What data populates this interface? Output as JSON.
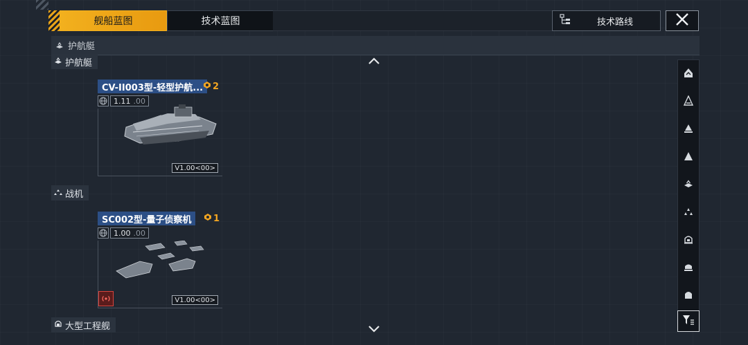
{
  "tabs": [
    {
      "label": "舰船蓝图",
      "active": true
    },
    {
      "label": "技术蓝图",
      "active": false
    }
  ],
  "route_button": {
    "label": "技术路线"
  },
  "category_bar": {
    "title": "护航艇"
  },
  "sections": [
    {
      "label": "护航艇"
    },
    {
      "label": "战机"
    },
    {
      "label": "大型工程舰"
    }
  ],
  "cards": [
    {
      "name": "CV-II003型-轻型护航...",
      "count": "2",
      "version": "1.11",
      "version_dim": ".00",
      "tag": "V1.00<00>",
      "ship_icon": "escort-ship-model"
    },
    {
      "name": "SC002型-量子侦察机",
      "count": "1",
      "version": "1.00",
      "version_dim": ".00",
      "tag": "V1.00<00>",
      "ship_icon": "recon-fighter-squad"
    }
  ],
  "sidebar_icons": [
    "frigate-filter-icon",
    "destroyer-filter-icon",
    "cruiser-filter-icon",
    "battlecruiser-filter-icon",
    "escort-filter-icon",
    "fighter-filter-icon",
    "corvette-filter-icon",
    "carrier-filter-icon",
    "engineering-filter-icon"
  ],
  "colors": {
    "accent": "#f2b01e",
    "name_bg": "#2c4f86",
    "count": "#f3a521",
    "alert": "#d9443d"
  }
}
